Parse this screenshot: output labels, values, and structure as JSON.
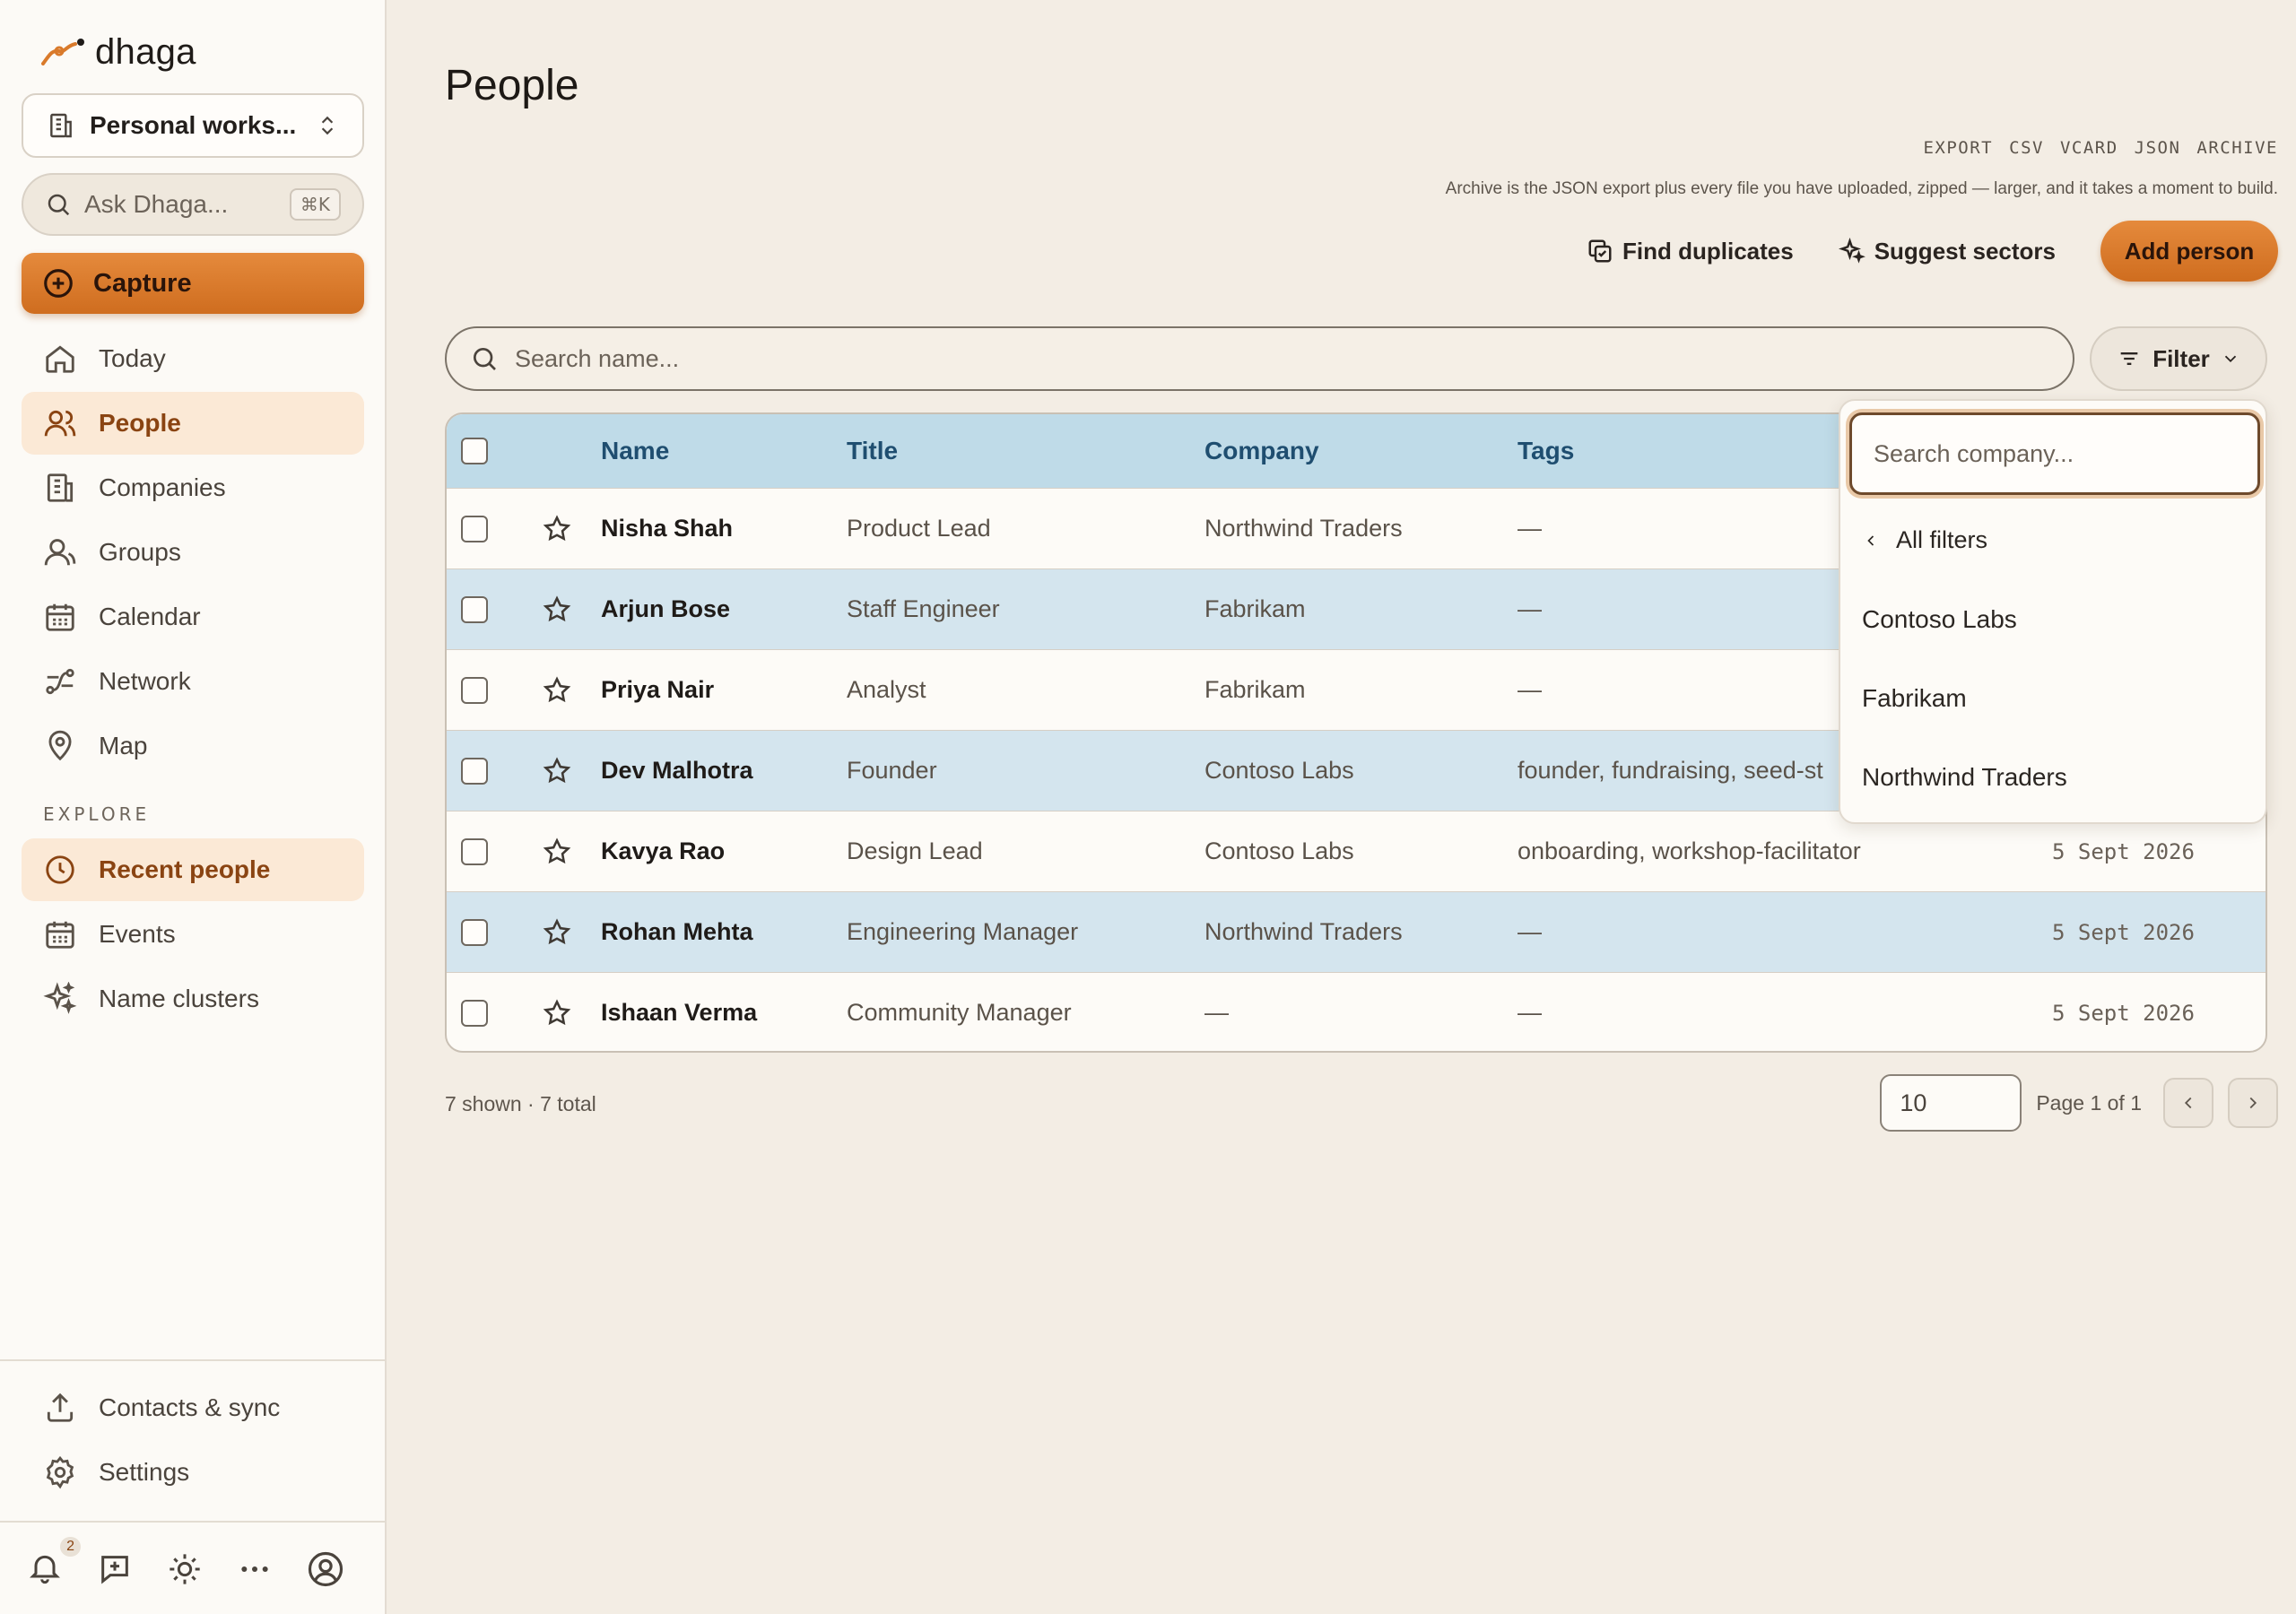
{
  "app": {
    "brand": "dhaga"
  },
  "sidebar": {
    "workspace": "Personal works...",
    "ask": {
      "label": "Ask Dhaga...",
      "shortcut": "⌘K"
    },
    "capture": "Capture",
    "nav": [
      {
        "label": "Today",
        "icon": "home-icon",
        "active": false
      },
      {
        "label": "People",
        "icon": "people-icon",
        "active": true
      },
      {
        "label": "Companies",
        "icon": "building-icon",
        "active": false
      },
      {
        "label": "Groups",
        "icon": "groups-icon",
        "active": false
      },
      {
        "label": "Calendar",
        "icon": "calendar-icon",
        "active": false
      },
      {
        "label": "Network",
        "icon": "network-icon",
        "active": false
      },
      {
        "label": "Map",
        "icon": "map-pin-icon",
        "active": false
      }
    ],
    "explore_label": "EXPLORE",
    "explore": [
      {
        "label": "Recent people",
        "icon": "clock-icon",
        "active": true
      },
      {
        "label": "Events",
        "icon": "calendar-icon",
        "active": false
      },
      {
        "label": "Name clusters",
        "icon": "sparkle-icon",
        "active": false
      }
    ],
    "footer": [
      {
        "label": "Contacts & sync",
        "icon": "upload-icon"
      },
      {
        "label": "Settings",
        "icon": "gear-icon"
      }
    ],
    "notifications_count": "2"
  },
  "header": {
    "title": "People",
    "export": [
      "EXPORT",
      "CSV",
      "VCARD",
      "JSON",
      "ARCHIVE"
    ],
    "export_note": "Archive is the JSON export plus every file you have uploaded, zipped — larger, and it takes a moment to build.",
    "find_duplicates": "Find duplicates",
    "suggest_sectors": "Suggest sectors",
    "add_person": "Add person"
  },
  "search": {
    "placeholder": "Search name..."
  },
  "filter": {
    "label": "Filter",
    "search_placeholder": "Search company...",
    "back": "All filters",
    "options": [
      "Contoso Labs",
      "Fabrikam",
      "Northwind Traders"
    ]
  },
  "table": {
    "columns": [
      "Name",
      "Title",
      "Company",
      "Tags"
    ],
    "rows": [
      {
        "name": "Nisha Shah",
        "title": "Product Lead",
        "company": "Northwind Traders",
        "tags": "—",
        "date": ""
      },
      {
        "name": "Arjun Bose",
        "title": "Staff Engineer",
        "company": "Fabrikam",
        "tags": "—",
        "date": ""
      },
      {
        "name": "Priya Nair",
        "title": "Analyst",
        "company": "Fabrikam",
        "tags": "—",
        "date": ""
      },
      {
        "name": "Dev Malhotra",
        "title": "Founder",
        "company": "Contoso Labs",
        "tags": "founder, fundraising, seed-st",
        "date": ""
      },
      {
        "name": "Kavya Rao",
        "title": "Design Lead",
        "company": "Contoso Labs",
        "tags": "onboarding, workshop-facilitator",
        "date": "5 Sept 2026"
      },
      {
        "name": "Rohan Mehta",
        "title": "Engineering Manager",
        "company": "Northwind Traders",
        "tags": "—",
        "date": "5 Sept 2026"
      },
      {
        "name": "Ishaan Verma",
        "title": "Community Manager",
        "company": "—",
        "tags": "—",
        "date": "5 Sept 2026"
      }
    ]
  },
  "footer": {
    "count": "7 shown · 7 total",
    "page_size": "10",
    "page_info": "Page 1 of 1"
  },
  "colors": {
    "accent": "#d97a2b",
    "header_row": "#bfdbe8",
    "alt_row": "#d4e5ee",
    "active_nav": "#fbe9d6"
  }
}
